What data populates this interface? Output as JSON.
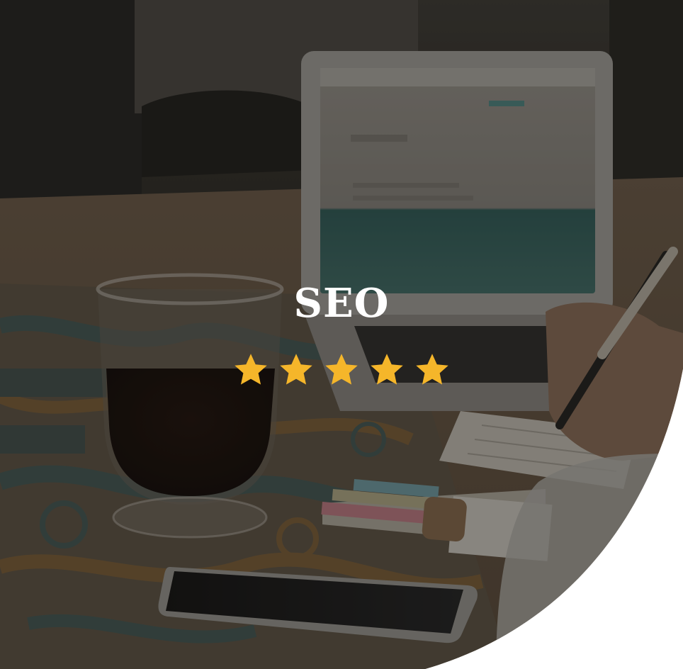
{
  "hero": {
    "title": "SEO"
  },
  "rating": {
    "value": 5,
    "max": 5,
    "star_color": "#F5B62A"
  },
  "colors": {
    "overlay": "#1B1712",
    "background": "#FFFFFF"
  },
  "icons": {
    "star": "star-icon"
  }
}
